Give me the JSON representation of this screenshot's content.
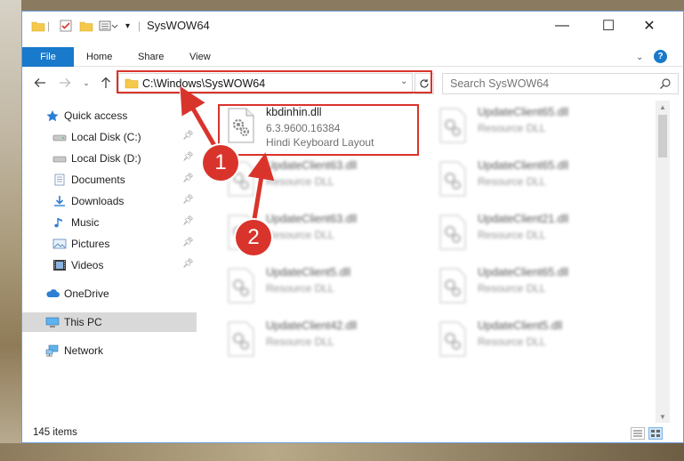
{
  "window": {
    "title": "SysWOW64",
    "controls": {
      "minimize": "—",
      "maximize": "☐",
      "close": "✕"
    }
  },
  "ribbon": {
    "tabs": [
      {
        "label": "File"
      },
      {
        "label": "Home"
      },
      {
        "label": "Share"
      },
      {
        "label": "View"
      }
    ]
  },
  "address": {
    "path": "C:\\Windows\\SysWOW64"
  },
  "search": {
    "placeholder": "Search SysWOW64"
  },
  "sidebar": {
    "items": [
      {
        "label": "Quick access",
        "icon": "star-icon"
      },
      {
        "label": "Local Disk (C:)",
        "icon": "drive-icon",
        "pinned": true
      },
      {
        "label": "Local Disk (D:)",
        "icon": "drive-icon",
        "pinned": true
      },
      {
        "label": "Documents",
        "icon": "documents-icon",
        "pinned": true
      },
      {
        "label": "Downloads",
        "icon": "downloads-icon",
        "pinned": true
      },
      {
        "label": "Music",
        "icon": "music-icon",
        "pinned": true
      },
      {
        "label": "Pictures",
        "icon": "pictures-icon",
        "pinned": true
      },
      {
        "label": "Videos",
        "icon": "videos-icon",
        "pinned": true
      },
      {
        "label": "OneDrive",
        "icon": "cloud-icon"
      },
      {
        "label": "This PC",
        "icon": "computer-icon",
        "selected": true
      },
      {
        "label": "Network",
        "icon": "network-icon"
      }
    ]
  },
  "files": {
    "highlighted": {
      "name": "kbdinhin.dll",
      "version": "6.3.9600.16384",
      "description": "Hindi Keyboard Layout"
    },
    "blurred": [
      {
        "name": "UpdateClient65.dll",
        "type": "Resource DLL"
      },
      {
        "name": "UpdateClient63.dll",
        "type": "Resource DLL"
      },
      {
        "name": "UpdateClient65.dll",
        "type": "Resource DLL"
      },
      {
        "name": "UpdateClient63.dll",
        "type": "Resource DLL"
      },
      {
        "name": "UpdateClient21.dll",
        "type": "Resource DLL"
      },
      {
        "name": "UpdateClient5.dll",
        "type": "Resource DLL"
      },
      {
        "name": "UpdateClient65.dll",
        "type": "Resource DLL"
      },
      {
        "name": "UpdateClient42.dll",
        "type": "Resource DLL"
      },
      {
        "name": "UpdateClient5.dll",
        "type": "Resource DLL"
      }
    ]
  },
  "status": {
    "item_count": "145 items"
  },
  "callouts": {
    "first": "1",
    "second": "2"
  },
  "colors": {
    "accent": "#1979ca",
    "highlight": "#d9342b",
    "selected_bg": "#d9d9d9"
  }
}
